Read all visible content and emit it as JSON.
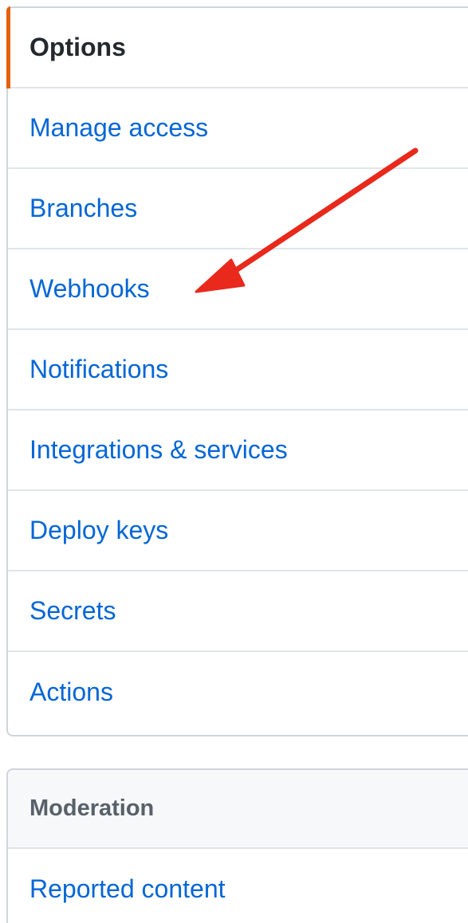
{
  "options_menu": {
    "items": [
      {
        "label": "Options",
        "selected": true
      },
      {
        "label": "Manage access"
      },
      {
        "label": "Branches"
      },
      {
        "label": "Webhooks"
      },
      {
        "label": "Notifications"
      },
      {
        "label": "Integrations & services"
      },
      {
        "label": "Deploy keys"
      },
      {
        "label": "Secrets"
      },
      {
        "label": "Actions"
      }
    ]
  },
  "moderation_menu": {
    "heading": "Moderation",
    "items": [
      {
        "label": "Reported content"
      }
    ]
  },
  "colors": {
    "link": "#0366d6",
    "selected_marker": "#e36209",
    "annotation_arrow": "#e8291c"
  },
  "annotation": {
    "icon": "arrow-icon",
    "points_to": "Webhooks"
  }
}
